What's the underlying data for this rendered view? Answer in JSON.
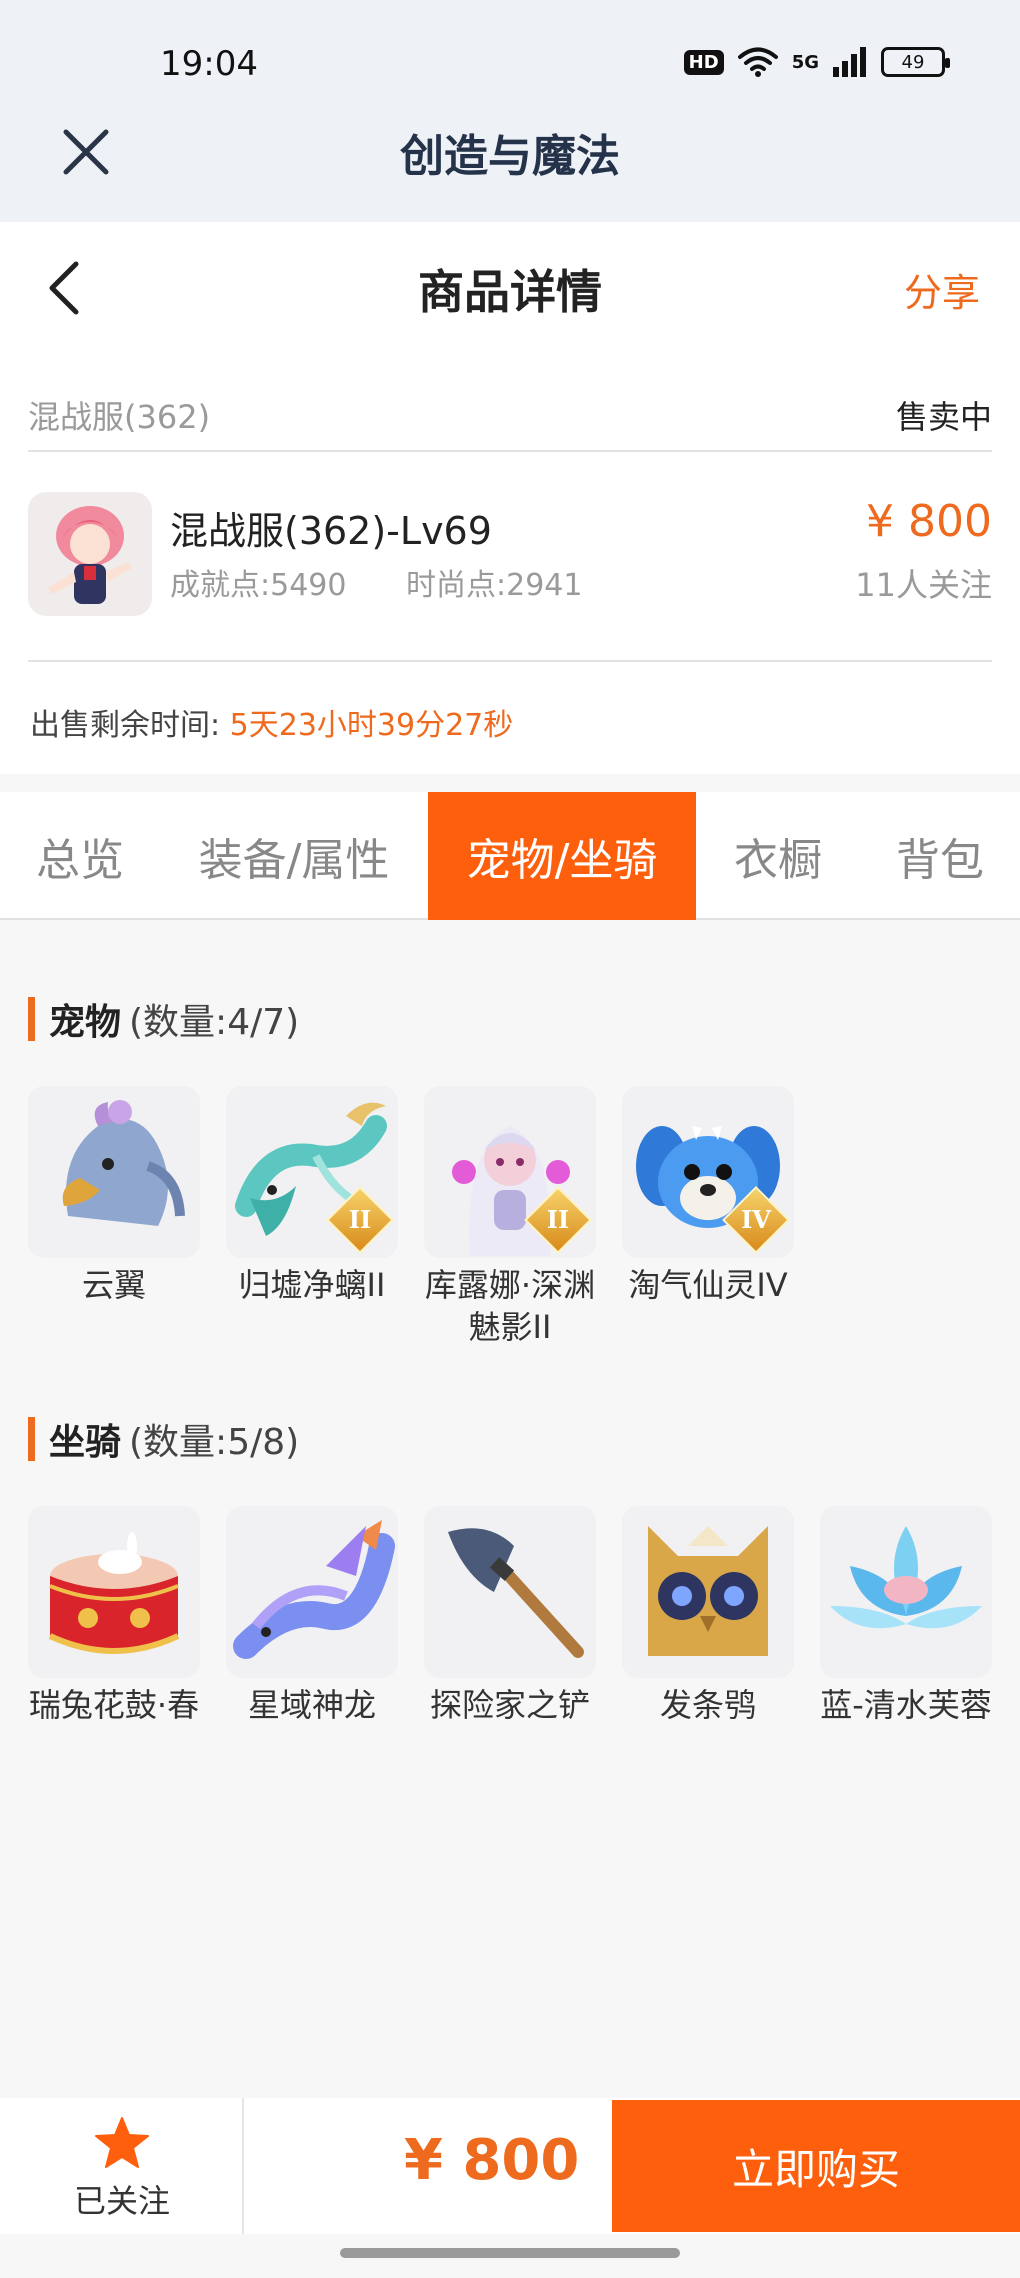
{
  "status_bar": {
    "time": "19:04",
    "hd": "HD",
    "network": "5G",
    "battery": "49"
  },
  "app": {
    "title": "创造与魔法"
  },
  "nav": {
    "title": "商品详情",
    "share": "分享"
  },
  "listing": {
    "server": "混战服(362)",
    "status": "售卖中",
    "character_name": "混战服(362)-Lv69",
    "achievement": "成就点:5490",
    "fashion": "时尚点:2941",
    "price": "¥ 800",
    "followers": "11人关注",
    "time_label": "出售剩余时间:",
    "time_value": "5天23小时39分27秒"
  },
  "tabs": [
    {
      "label": "总览"
    },
    {
      "label": "装备/属性"
    },
    {
      "label": "宠物/坐骑",
      "active": true
    },
    {
      "label": "衣橱"
    },
    {
      "label": "背包"
    }
  ],
  "pets": {
    "title": "宠物",
    "count": "(数量:4/7)",
    "items": [
      {
        "name": "云翼",
        "icon": "griffin-icon"
      },
      {
        "name": "归墟净螭II",
        "icon": "dragon-icon",
        "grade": "II"
      },
      {
        "name": "库露娜·深渊魅影II",
        "icon": "spirit-girl-icon",
        "grade": "II"
      },
      {
        "name": "淘气仙灵IV",
        "icon": "blue-pup-icon",
        "grade": "IV"
      }
    ]
  },
  "mounts": {
    "title": "坐骑",
    "count": "(数量:5/8)",
    "items": [
      {
        "name": "瑞兔花鼓·春",
        "icon": "rabbit-drum-icon"
      },
      {
        "name": "星域神龙",
        "icon": "star-dragon-icon"
      },
      {
        "name": "探险家之铲",
        "icon": "shovel-icon"
      },
      {
        "name": "发条鸮",
        "icon": "clockwork-owl-icon"
      },
      {
        "name": "蓝-清水芙蓉",
        "icon": "blue-lotus-icon"
      }
    ]
  },
  "bottom": {
    "follow_label": "已关注",
    "price": "¥ 800",
    "buy_label": "立即购买"
  },
  "colors": {
    "accent": "#fe5f0d",
    "price": "#ee6a1f",
    "header_bg": "#eef1f5"
  }
}
